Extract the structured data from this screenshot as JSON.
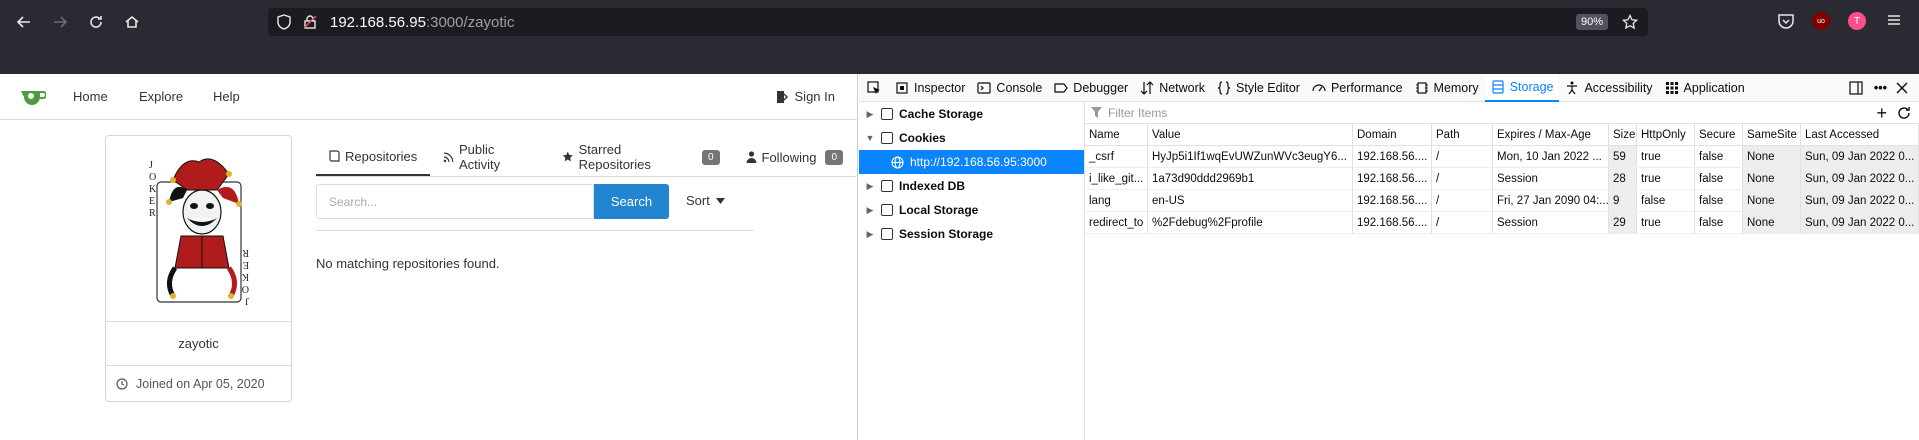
{
  "browser": {
    "url_host": "192.168.56.95",
    "url_path": ":3000/zayotic",
    "zoom": "90%"
  },
  "site": {
    "nav": [
      "Home",
      "Explore",
      "Help"
    ],
    "signin": "Sign In",
    "username": "zayotic",
    "joined": "Joined on Apr 05, 2020",
    "tabs": [
      {
        "label": "Repositories"
      },
      {
        "label": "Public Activity"
      },
      {
        "label": "Starred Repositories",
        "count": "0"
      },
      {
        "label": "Following",
        "count": "0"
      }
    ],
    "search_placeholder": "Search...",
    "search_button": "Search",
    "sort_label": "Sort",
    "empty_message": "No matching repositories found."
  },
  "devtools": {
    "tabs": [
      "Inspector",
      "Console",
      "Debugger",
      "Network",
      "Style Editor",
      "Performance",
      "Memory",
      "Storage",
      "Accessibility",
      "Application"
    ],
    "active_tab": "Storage",
    "tree": {
      "cache_storage": "Cache Storage",
      "cookies": "Cookies",
      "cookie_host": "http://192.168.56.95:3000",
      "indexed_db": "Indexed DB",
      "local_storage": "Local Storage",
      "session_storage": "Session Storage"
    },
    "filter_placeholder": "Filter Items",
    "columns": [
      "Name",
      "Value",
      "Domain",
      "Path",
      "Expires / Max-Age",
      "Size",
      "HttpOnly",
      "Secure",
      "SameSite",
      "Last Accessed"
    ],
    "rows": [
      [
        "_csrf",
        "HyJp5i1If1wqEvUWZunWVc3eugY6...",
        "192.168.56....",
        "/",
        "Mon, 10 Jan 2022 ...",
        "59",
        "true",
        "false",
        "None",
        "Sun, 09 Jan 2022 0..."
      ],
      [
        "i_like_git...",
        "1a73d90ddd2969b1",
        "192.168.56....",
        "/",
        "Session",
        "28",
        "true",
        "false",
        "None",
        "Sun, 09 Jan 2022 0..."
      ],
      [
        "lang",
        "en-US",
        "192.168.56....",
        "/",
        "Fri, 27 Jan 2090 04:...",
        "9",
        "false",
        "false",
        "None",
        "Sun, 09 Jan 2022 0..."
      ],
      [
        "redirect_to",
        "%2Fdebug%2Fprofile",
        "192.168.56....",
        "/",
        "Session",
        "29",
        "true",
        "false",
        "None",
        "Sun, 09 Jan 2022 0..."
      ]
    ]
  }
}
